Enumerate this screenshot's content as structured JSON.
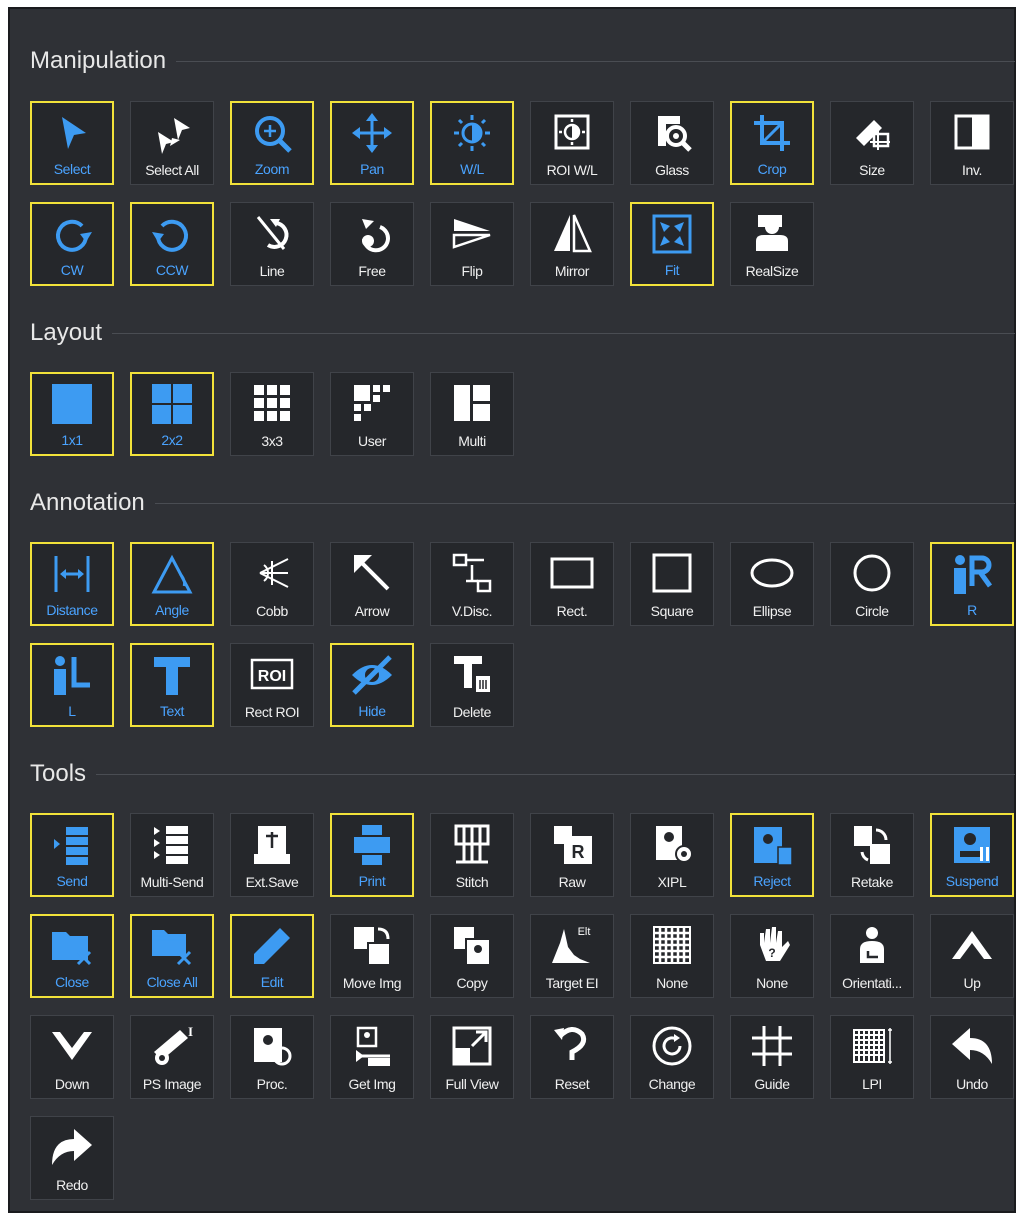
{
  "sections": {
    "manipulation": {
      "title": "Manipulation",
      "items": [
        {
          "label": "Select",
          "icon": "select-arrow-icon",
          "selected": true
        },
        {
          "label": "Select All",
          "icon": "select-all-icon",
          "selected": false
        },
        {
          "label": "Zoom",
          "icon": "zoom-icon",
          "selected": true
        },
        {
          "label": "Pan",
          "icon": "pan-icon",
          "selected": true
        },
        {
          "label": "W/L",
          "icon": "window-level-icon",
          "selected": true
        },
        {
          "label": "ROI W/L",
          "icon": "roi-window-level-icon",
          "selected": false
        },
        {
          "label": "Glass",
          "icon": "magnifier-glass-icon",
          "selected": false
        },
        {
          "label": "Crop",
          "icon": "crop-icon",
          "selected": true
        },
        {
          "label": "Size",
          "icon": "size-ruler-icon",
          "selected": false
        },
        {
          "label": "Inv.",
          "icon": "invert-icon",
          "selected": false
        },
        {
          "label": "CW",
          "icon": "rotate-clockwise-icon",
          "selected": true
        },
        {
          "label": "CCW",
          "icon": "rotate-counterclockwise-icon",
          "selected": true
        },
        {
          "label": "Line",
          "icon": "rotate-line-icon",
          "selected": false
        },
        {
          "label": "Free",
          "icon": "free-rotate-icon",
          "selected": false
        },
        {
          "label": "Flip",
          "icon": "flip-icon",
          "selected": false
        },
        {
          "label": "Mirror",
          "icon": "mirror-icon",
          "selected": false
        },
        {
          "label": "Fit",
          "icon": "fit-icon",
          "selected": true
        },
        {
          "label": "RealSize",
          "icon": "real-size-icon",
          "selected": false
        }
      ]
    },
    "layout": {
      "title": "Layout",
      "items": [
        {
          "label": "1x1",
          "icon": "layout-1x1-icon",
          "selected": true
        },
        {
          "label": "2x2",
          "icon": "layout-2x2-icon",
          "selected": true
        },
        {
          "label": "3x3",
          "icon": "layout-3x3-icon",
          "selected": false
        },
        {
          "label": "User",
          "icon": "layout-user-icon",
          "selected": false
        },
        {
          "label": "Multi",
          "icon": "layout-multi-icon",
          "selected": false
        }
      ]
    },
    "annotation": {
      "title": "Annotation",
      "items": [
        {
          "label": "Distance",
          "icon": "distance-icon",
          "selected": true
        },
        {
          "label": "Angle",
          "icon": "angle-icon",
          "selected": true
        },
        {
          "label": "Cobb",
          "icon": "cobb-icon",
          "selected": false
        },
        {
          "label": "Arrow",
          "icon": "arrow-icon",
          "selected": false
        },
        {
          "label": "V.Disc.",
          "icon": "vertebral-disc-icon",
          "selected": false
        },
        {
          "label": "Rect.",
          "icon": "rectangle-icon",
          "selected": false
        },
        {
          "label": "Square",
          "icon": "square-icon",
          "selected": false
        },
        {
          "label": "Ellipse",
          "icon": "ellipse-icon",
          "selected": false
        },
        {
          "label": "Circle",
          "icon": "circle-icon",
          "selected": false
        },
        {
          "label": "R",
          "icon": "right-marker-icon",
          "selected": true
        },
        {
          "label": "L",
          "icon": "left-marker-icon",
          "selected": true
        },
        {
          "label": "Text",
          "icon": "text-icon",
          "selected": true
        },
        {
          "label": "Rect ROI",
          "icon": "rect-roi-icon",
          "selected": false
        },
        {
          "label": "Hide",
          "icon": "hide-eye-icon",
          "selected": true
        },
        {
          "label": "Delete",
          "icon": "delete-text-icon",
          "selected": false
        }
      ]
    },
    "tools": {
      "title": "Tools",
      "items": [
        {
          "label": "Send",
          "icon": "send-icon",
          "selected": true
        },
        {
          "label": "Multi-Send",
          "icon": "multi-send-icon",
          "selected": false
        },
        {
          "label": "Ext.Save",
          "icon": "external-save-icon",
          "selected": false
        },
        {
          "label": "Print",
          "icon": "print-icon",
          "selected": true
        },
        {
          "label": "Stitch",
          "icon": "stitch-icon",
          "selected": false
        },
        {
          "label": "Raw",
          "icon": "raw-icon",
          "selected": false
        },
        {
          "label": "XIPL",
          "icon": "xipl-icon",
          "selected": false
        },
        {
          "label": "Reject",
          "icon": "reject-icon",
          "selected": true
        },
        {
          "label": "Retake",
          "icon": "retake-icon",
          "selected": false
        },
        {
          "label": "Suspend",
          "icon": "suspend-icon",
          "selected": true
        },
        {
          "label": "Close",
          "icon": "close-folder-icon",
          "selected": true
        },
        {
          "label": "Close All",
          "icon": "close-all-folders-icon",
          "selected": true
        },
        {
          "label": "Edit",
          "icon": "edit-pencil-icon",
          "selected": true
        },
        {
          "label": "Move Img",
          "icon": "move-image-icon",
          "selected": false
        },
        {
          "label": "Copy",
          "icon": "copy-icon",
          "selected": false
        },
        {
          "label": "Target EI",
          "icon": "target-ei-icon",
          "selected": false
        },
        {
          "label": "None",
          "icon": "grid-none-icon",
          "selected": false
        },
        {
          "label": "None",
          "icon": "hand-none-icon",
          "selected": false
        },
        {
          "label": "Orientati...",
          "icon": "orientation-icon",
          "selected": false
        },
        {
          "label": "Up",
          "icon": "chevron-up-icon",
          "selected": false
        },
        {
          "label": "Down",
          "icon": "chevron-down-icon",
          "selected": false
        },
        {
          "label": "PS Image",
          "icon": "ps-image-icon",
          "selected": false
        },
        {
          "label": "Proc.",
          "icon": "process-icon",
          "selected": false
        },
        {
          "label": "Get Img",
          "icon": "get-image-icon",
          "selected": false
        },
        {
          "label": "Full View",
          "icon": "full-view-icon",
          "selected": false
        },
        {
          "label": "Reset",
          "icon": "reset-icon",
          "selected": false
        },
        {
          "label": "Change",
          "icon": "change-icon",
          "selected": false
        },
        {
          "label": "Guide",
          "icon": "guide-grid-icon",
          "selected": false
        },
        {
          "label": "LPI",
          "icon": "lpi-icon",
          "selected": false
        },
        {
          "label": "Undo",
          "icon": "undo-icon",
          "selected": false
        },
        {
          "label": "Redo",
          "icon": "redo-icon",
          "selected": false
        }
      ]
    }
  },
  "colors": {
    "panel_background": "#2f3136",
    "button_background": "#25272b",
    "selected_border": "#f2e23a",
    "selected_label": "#4aa3ff",
    "icon_blue": "#3d9bf2",
    "label_white": "#f0f0f0"
  }
}
